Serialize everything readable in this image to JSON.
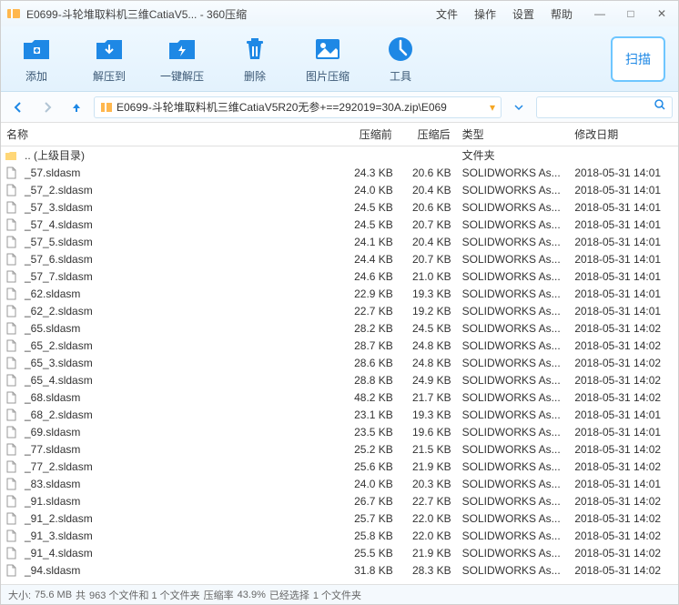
{
  "titlebar": {
    "title": "E0699-斗轮堆取料机三维CatiaV5... - 360压缩",
    "menus": [
      "文件",
      "操作",
      "设置",
      "帮助"
    ]
  },
  "toolbar": {
    "add": "添加",
    "extract": "解压到",
    "oneclick": "一键解压",
    "delete": "删除",
    "imgcompress": "图片压缩",
    "tools": "工具",
    "scan": "扫描"
  },
  "path": "E0699-斗轮堆取料机三维CatiaV5R20无参+==292019=30A.zip\\E069",
  "columns": {
    "name": "名称",
    "pre": "压缩前",
    "post": "压缩后",
    "type": "类型",
    "date": "修改日期"
  },
  "parent": {
    "name": ".. (上级目录)",
    "type": "文件夹"
  },
  "files": [
    {
      "name": "_57.sldasm",
      "pre": "24.3 KB",
      "post": "20.6 KB",
      "type": "SOLIDWORKS As...",
      "date": "2018-05-31 14:01"
    },
    {
      "name": "_57_2.sldasm",
      "pre": "24.0 KB",
      "post": "20.4 KB",
      "type": "SOLIDWORKS As...",
      "date": "2018-05-31 14:01"
    },
    {
      "name": "_57_3.sldasm",
      "pre": "24.5 KB",
      "post": "20.6 KB",
      "type": "SOLIDWORKS As...",
      "date": "2018-05-31 14:01"
    },
    {
      "name": "_57_4.sldasm",
      "pre": "24.5 KB",
      "post": "20.7 KB",
      "type": "SOLIDWORKS As...",
      "date": "2018-05-31 14:01"
    },
    {
      "name": "_57_5.sldasm",
      "pre": "24.1 KB",
      "post": "20.4 KB",
      "type": "SOLIDWORKS As...",
      "date": "2018-05-31 14:01"
    },
    {
      "name": "_57_6.sldasm",
      "pre": "24.4 KB",
      "post": "20.7 KB",
      "type": "SOLIDWORKS As...",
      "date": "2018-05-31 14:01"
    },
    {
      "name": "_57_7.sldasm",
      "pre": "24.6 KB",
      "post": "21.0 KB",
      "type": "SOLIDWORKS As...",
      "date": "2018-05-31 14:01"
    },
    {
      "name": "_62.sldasm",
      "pre": "22.9 KB",
      "post": "19.3 KB",
      "type": "SOLIDWORKS As...",
      "date": "2018-05-31 14:01"
    },
    {
      "name": "_62_2.sldasm",
      "pre": "22.7 KB",
      "post": "19.2 KB",
      "type": "SOLIDWORKS As...",
      "date": "2018-05-31 14:01"
    },
    {
      "name": "_65.sldasm",
      "pre": "28.2 KB",
      "post": "24.5 KB",
      "type": "SOLIDWORKS As...",
      "date": "2018-05-31 14:02"
    },
    {
      "name": "_65_2.sldasm",
      "pre": "28.7 KB",
      "post": "24.8 KB",
      "type": "SOLIDWORKS As...",
      "date": "2018-05-31 14:02"
    },
    {
      "name": "_65_3.sldasm",
      "pre": "28.6 KB",
      "post": "24.8 KB",
      "type": "SOLIDWORKS As...",
      "date": "2018-05-31 14:02"
    },
    {
      "name": "_65_4.sldasm",
      "pre": "28.8 KB",
      "post": "24.9 KB",
      "type": "SOLIDWORKS As...",
      "date": "2018-05-31 14:02"
    },
    {
      "name": "_68.sldasm",
      "pre": "48.2 KB",
      "post": "21.7 KB",
      "type": "SOLIDWORKS As...",
      "date": "2018-05-31 14:02"
    },
    {
      "name": "_68_2.sldasm",
      "pre": "23.1 KB",
      "post": "19.3 KB",
      "type": "SOLIDWORKS As...",
      "date": "2018-05-31 14:01"
    },
    {
      "name": "_69.sldasm",
      "pre": "23.5 KB",
      "post": "19.6 KB",
      "type": "SOLIDWORKS As...",
      "date": "2018-05-31 14:01"
    },
    {
      "name": "_77.sldasm",
      "pre": "25.2 KB",
      "post": "21.5 KB",
      "type": "SOLIDWORKS As...",
      "date": "2018-05-31 14:02"
    },
    {
      "name": "_77_2.sldasm",
      "pre": "25.6 KB",
      "post": "21.9 KB",
      "type": "SOLIDWORKS As...",
      "date": "2018-05-31 14:02"
    },
    {
      "name": "_83.sldasm",
      "pre": "24.0 KB",
      "post": "20.3 KB",
      "type": "SOLIDWORKS As...",
      "date": "2018-05-31 14:01"
    },
    {
      "name": "_91.sldasm",
      "pre": "26.7 KB",
      "post": "22.7 KB",
      "type": "SOLIDWORKS As...",
      "date": "2018-05-31 14:02"
    },
    {
      "name": "_91_2.sldasm",
      "pre": "25.7 KB",
      "post": "22.0 KB",
      "type": "SOLIDWORKS As...",
      "date": "2018-05-31 14:02"
    },
    {
      "name": "_91_3.sldasm",
      "pre": "25.8 KB",
      "post": "22.0 KB",
      "type": "SOLIDWORKS As...",
      "date": "2018-05-31 14:02"
    },
    {
      "name": "_91_4.sldasm",
      "pre": "25.5 KB",
      "post": "21.9 KB",
      "type": "SOLIDWORKS As...",
      "date": "2018-05-31 14:02"
    },
    {
      "name": "_94.sldasm",
      "pre": "31.8 KB",
      "post": "28.3 KB",
      "type": "SOLIDWORKS As...",
      "date": "2018-05-31 14:02"
    }
  ],
  "status": {
    "size_label": "大小:",
    "size": "75.6 MB",
    "total_label": "共",
    "total": "963 个文件和 1 个文件夹",
    "ratio_label": "压缩率",
    "ratio": "43.9%",
    "sel_label": "已经选择",
    "sel": "1 个文件夹"
  }
}
